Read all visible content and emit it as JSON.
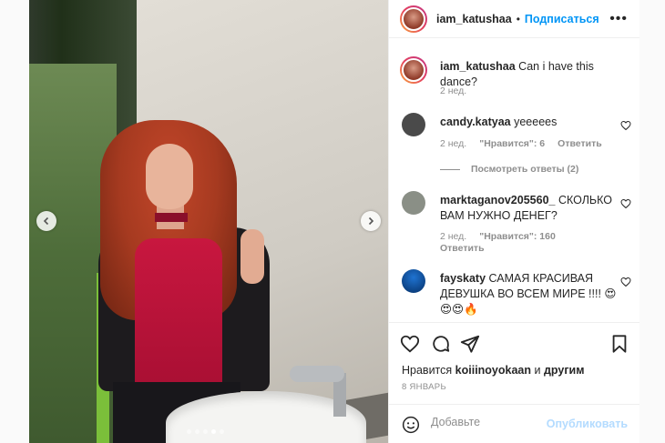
{
  "post": {
    "author": "iam_katushaa",
    "follow_label": "Подписаться",
    "separator": "•",
    "more_label": "•••",
    "caption": "Can i have this dance?",
    "caption_time": "2 нед."
  },
  "comments": [
    {
      "user": "candy.katyaa",
      "text": "yeeeees",
      "time": "2 нед.",
      "likes": "\"Нравится\": 6",
      "reply": "Ответить",
      "view_replies": "Посмотреть ответы (2)",
      "avatar_color": "#4a4a4a"
    },
    {
      "user": "marktaganov205560_",
      "text": "СКОЛЬКО ВАМ НУЖНО ДЕНЕГ?",
      "time": "2 нед.",
      "likes": "\"Нравится\": 160",
      "reply": "Ответить",
      "avatar_color": "#8a8f86"
    },
    {
      "user": "fayskaty",
      "text": "САМАЯ КРАСИВАЯ ДЕВУШКА ВО ВСЕМ МИРЕ !!!! 😍 😍😍🔥",
      "avatar_color": "#0a4d9c"
    }
  ],
  "footer": {
    "likes_prefix": "Нравится",
    "likes_user": "koiiinoyokaan",
    "likes_mid": "и",
    "likes_others": "другим",
    "date": "8 ЯНВАРЬ",
    "comment_placeholder": "Добавьте",
    "publish_label": "Опубликовать"
  },
  "carousel": {
    "slides": 5,
    "active_slide": 4
  },
  "colors": {
    "accent": "#0095f6",
    "muted": "#8e8e8e",
    "text": "#262626",
    "publish_disabled": "#b3dbff"
  },
  "icons": [
    "chevron-left-icon",
    "chevron-right-icon",
    "heart-icon",
    "comment-icon",
    "share-icon",
    "bookmark-icon",
    "emoji-icon",
    "more-icon"
  ]
}
